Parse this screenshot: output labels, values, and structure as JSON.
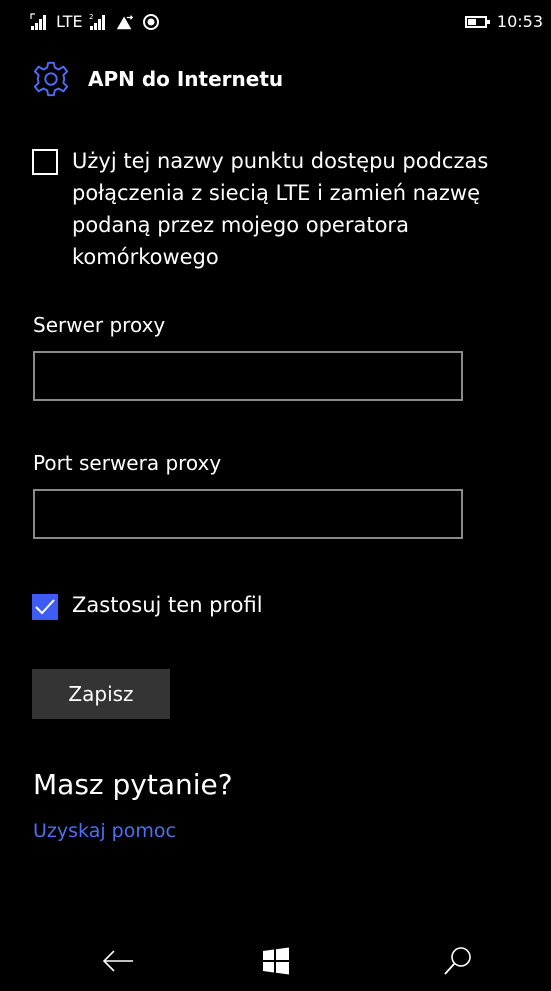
{
  "status_bar": {
    "network_type": "LTE",
    "time": "10:53",
    "icons": [
      "signal-icon",
      "signal-sim2-icon",
      "data-transfer-icon",
      "location-icon",
      "battery-icon"
    ]
  },
  "header": {
    "icon": "gear-icon",
    "title": "APN do Internetu"
  },
  "apn_checkbox": {
    "checked": false,
    "label": "Użyj tej nazwy punktu dostępu podczas połączenia z siecią LTE i zamień nazwę podaną przez mojego operatora komórkowego"
  },
  "proxy_server": {
    "label": "Serwer proxy",
    "value": ""
  },
  "proxy_port": {
    "label": "Port serwera proxy",
    "value": ""
  },
  "profile_checkbox": {
    "checked": true,
    "label": "Zastosuj ten profil"
  },
  "save_button": {
    "label": "Zapisz"
  },
  "help": {
    "heading": "Masz pytanie?",
    "link": "Uzyskaj pomoc"
  },
  "nav": {
    "icons": [
      "back-icon",
      "windows-start-icon",
      "search-icon"
    ]
  },
  "colors": {
    "background": "#000000",
    "accent": "#3d5cf5",
    "link": "#4f6df5",
    "input_border": "#8a8a8a",
    "button_bg": "#343434"
  }
}
